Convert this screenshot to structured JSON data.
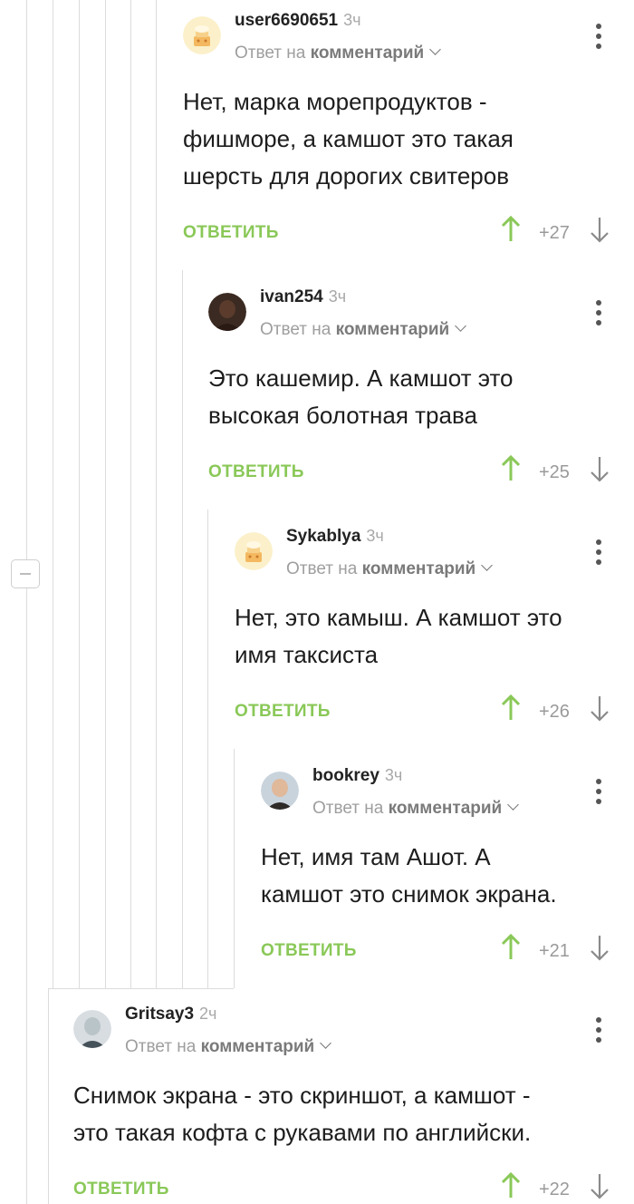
{
  "colors": {
    "accent_green": "#8ac858",
    "thread_line": "#dcdcdc",
    "username": "#222222",
    "muted": "#a8a8a8"
  },
  "collapse_control": {
    "icon": "minus-icon"
  },
  "reply_prefix": "Ответ на",
  "reply_target": "комментарий",
  "reply_action": "ОТВЕТИТЬ",
  "comments": [
    {
      "username": "user6690651",
      "time": "3ч",
      "avatar": "cake-avatar",
      "lines": [
        "Нет, марка морепродуктов -",
        "фишморе, а камшот это такая",
        "шерсть для дорогих свитеров"
      ],
      "score": "+27"
    },
    {
      "username": "ivan254",
      "time": "3ч",
      "avatar": "photo-avatar",
      "lines": [
        "Это кашемир. А камшот это",
        "высокая болотная трава"
      ],
      "score": "+25"
    },
    {
      "username": "Sykablya",
      "time": "3ч",
      "avatar": "cake-avatar",
      "lines": [
        "Нет, это камыш. А камшот это",
        "имя таксиста"
      ],
      "score": "+26"
    },
    {
      "username": "bookrey",
      "time": "3ч",
      "avatar": "photo-avatar",
      "lines": [
        "Нет, имя там Ашот. А",
        "камшот это снимок экрана."
      ],
      "score": "+21"
    },
    {
      "username": "Gritsay3",
      "time": "2ч",
      "avatar": "photo-avatar",
      "lines": [
        "Снимок экрана - это скриншот, а камшот -",
        "это такая кофта с рукавами по английски."
      ],
      "score": "+22"
    }
  ]
}
